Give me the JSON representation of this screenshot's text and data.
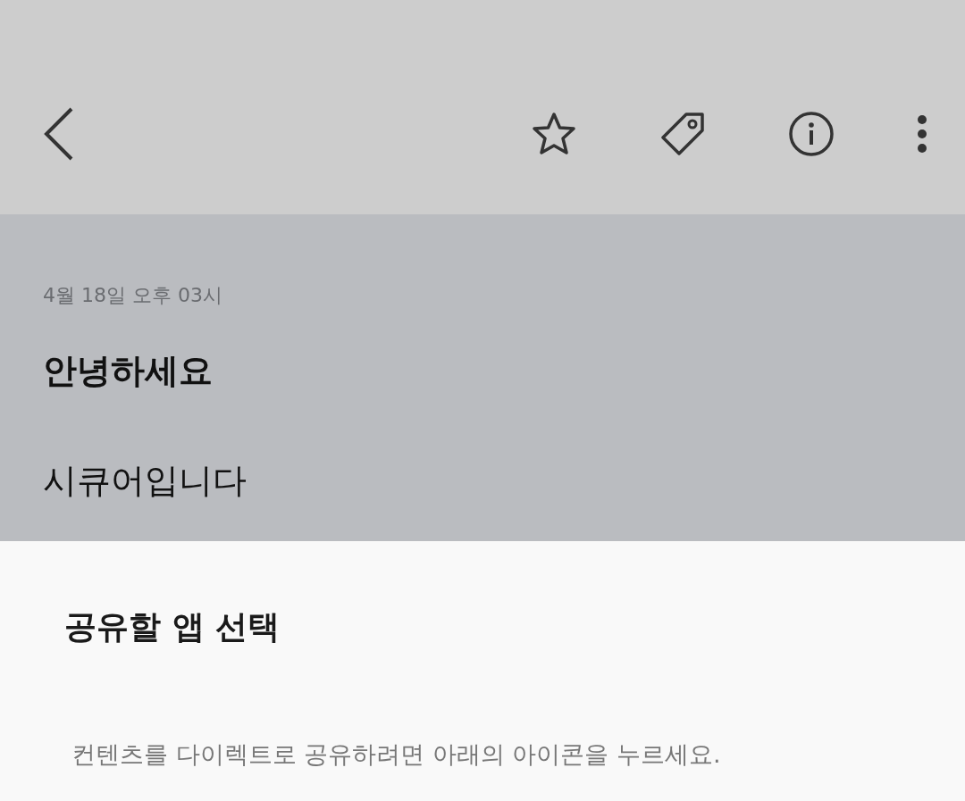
{
  "toolbar": {
    "actions": [
      {
        "kind": "star"
      },
      {
        "kind": "tag"
      },
      {
        "kind": "info"
      },
      {
        "kind": "more"
      }
    ]
  },
  "note": {
    "date": "4월 18일 오후 03시",
    "title": "안녕하세요",
    "body": "시큐어입니다"
  },
  "share_sheet": {
    "title": "공유할 앱 선택",
    "description": "컨텐츠를 다이렉트로 공유하려면 아래의 아이콘을 누르세요."
  }
}
